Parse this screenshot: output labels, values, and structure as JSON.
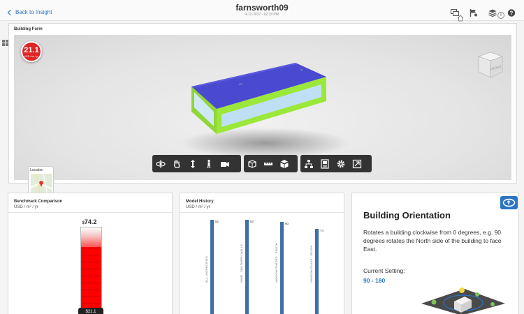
{
  "header": {
    "back_label": "Back to Insight",
    "title": "farnsworth09",
    "subtitle": "4.12.2017 - 02:19 PM",
    "icons": [
      "screens-icon",
      "flag-settings-icon",
      "layers-icon",
      "help-icon"
    ]
  },
  "building_form": {
    "title": "Building Form",
    "badge_value": "21.1",
    "badge_unit": "USD / m² / yr",
    "location_label": "Location"
  },
  "toolbar": {
    "groups": [
      [
        "orbit-icon",
        "pan-icon",
        "zoom-icon",
        "walk-icon",
        "camera-icon"
      ],
      [
        "section-box-icon",
        "measure-icon",
        "explode-icon"
      ],
      [
        "model-browser-icon",
        "properties-icon",
        "settings-icon",
        "fullscreen-icon"
      ]
    ]
  },
  "benchmark": {
    "title": "Benchmark Comparison",
    "unit": "USD / m² / yr",
    "top_value_currency": "$",
    "top_value": "74.2",
    "current_label": "$21.1",
    "current_value": 21.1,
    "max_value": 74.2
  },
  "model_history": {
    "title": "Model History",
    "unit": "USD / m² / yr",
    "entries": [
      {
        "label": "ALL UNSPECIFIED",
        "value": "82"
      },
      {
        "label": "WWR - SOUTHERN WALLS",
        "value": "82"
      },
      {
        "label": "WINDOW SHADES - SOUTH",
        "value": "80"
      },
      {
        "label": "WINDOW GLASS - SOUTH",
        "value": "74"
      }
    ]
  },
  "orientation": {
    "title": "Building Orientation",
    "description": "Rotates a building clockwise from 0 degrees, e.g. 90 degrees rotates the North side of the building to face East.",
    "current_label": "Current Setting:",
    "current_value": "90 - 180"
  },
  "colors": {
    "accent": "#2a74c4",
    "roof": "#4a4ad0",
    "walls": "#9be83a",
    "glass": "#bfe0f4",
    "badge": "#e02424",
    "history_bar": "#3e6fa8"
  }
}
